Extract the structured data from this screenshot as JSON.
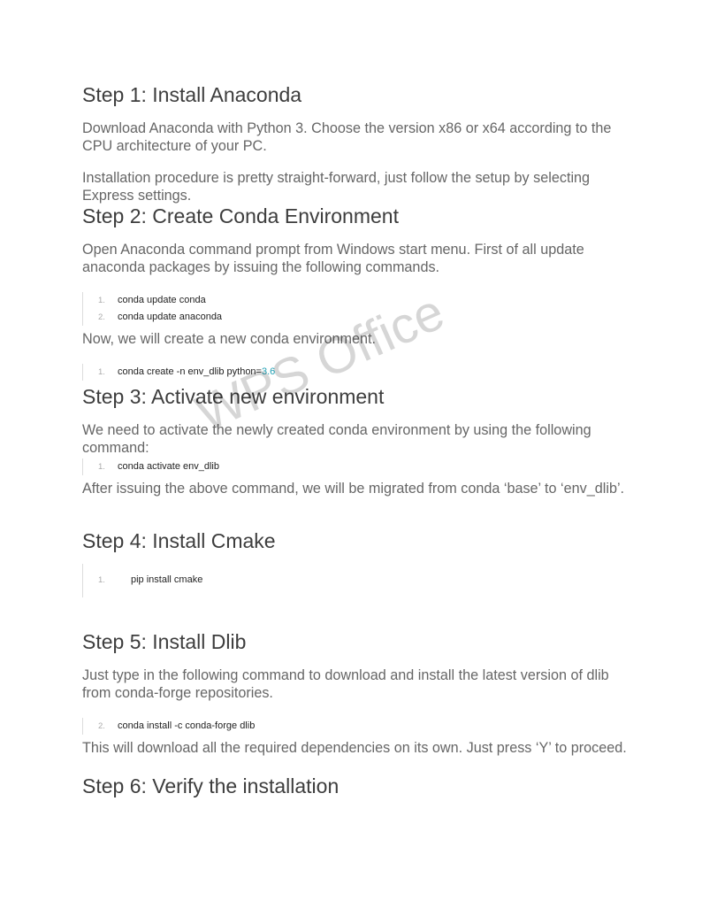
{
  "step1": {
    "heading": "Step 1: Install Anaconda",
    "para1": "Download Anaconda with Python 3. Choose the version x86 or x64 according to the CPU architecture of your PC.",
    "para2": "Installation procedure is pretty straight-forward, just follow the setup by selecting Express settings."
  },
  "step2": {
    "heading": "Step 2: Create Conda Environment",
    "para1": "Open Anaconda command prompt from Windows start menu. First of all update anaconda packages by issuing the following commands.",
    "code1": [
      {
        "num": "1.",
        "cmd": "conda update conda"
      },
      {
        "num": "2.",
        "cmd": "conda update anaconda"
      }
    ],
    "para2": "Now, we will create a new conda environment.",
    "code2": {
      "num": "1.",
      "cmd": "conda create -n env_dlib python=",
      "value": "3.6"
    }
  },
  "step3": {
    "heading": "Step 3: Activate new environment",
    "para1": "We need to activate the newly created conda environment by using the following command:",
    "code": {
      "num": "1.",
      "cmd": "conda activate env_dlib"
    },
    "para2": "After issuing the above command, we will be migrated from conda ‘base’ to ‘env_dlib’."
  },
  "step4": {
    "heading": "Step 4: Install Cmake",
    "code": {
      "num": "1.",
      "cmd": "pip install cmake"
    }
  },
  "step5": {
    "heading": "Step 5: Install Dlib",
    "para1": "Just type in the following command to download and install the latest version of dlib from conda-forge repositories.",
    "code": {
      "num": "2.",
      "cmd": "conda install -c conda-forge dlib"
    },
    "para2": "This will download all the required dependencies on its own. Just press ‘Y’ to proceed."
  },
  "step6": {
    "heading": "Step 6: Verify the installation"
  },
  "watermark": "WPS Office",
  "colors": {
    "code_number": "#1e9fb3",
    "heading": "#3d3d3d",
    "body_text": "#666666"
  }
}
